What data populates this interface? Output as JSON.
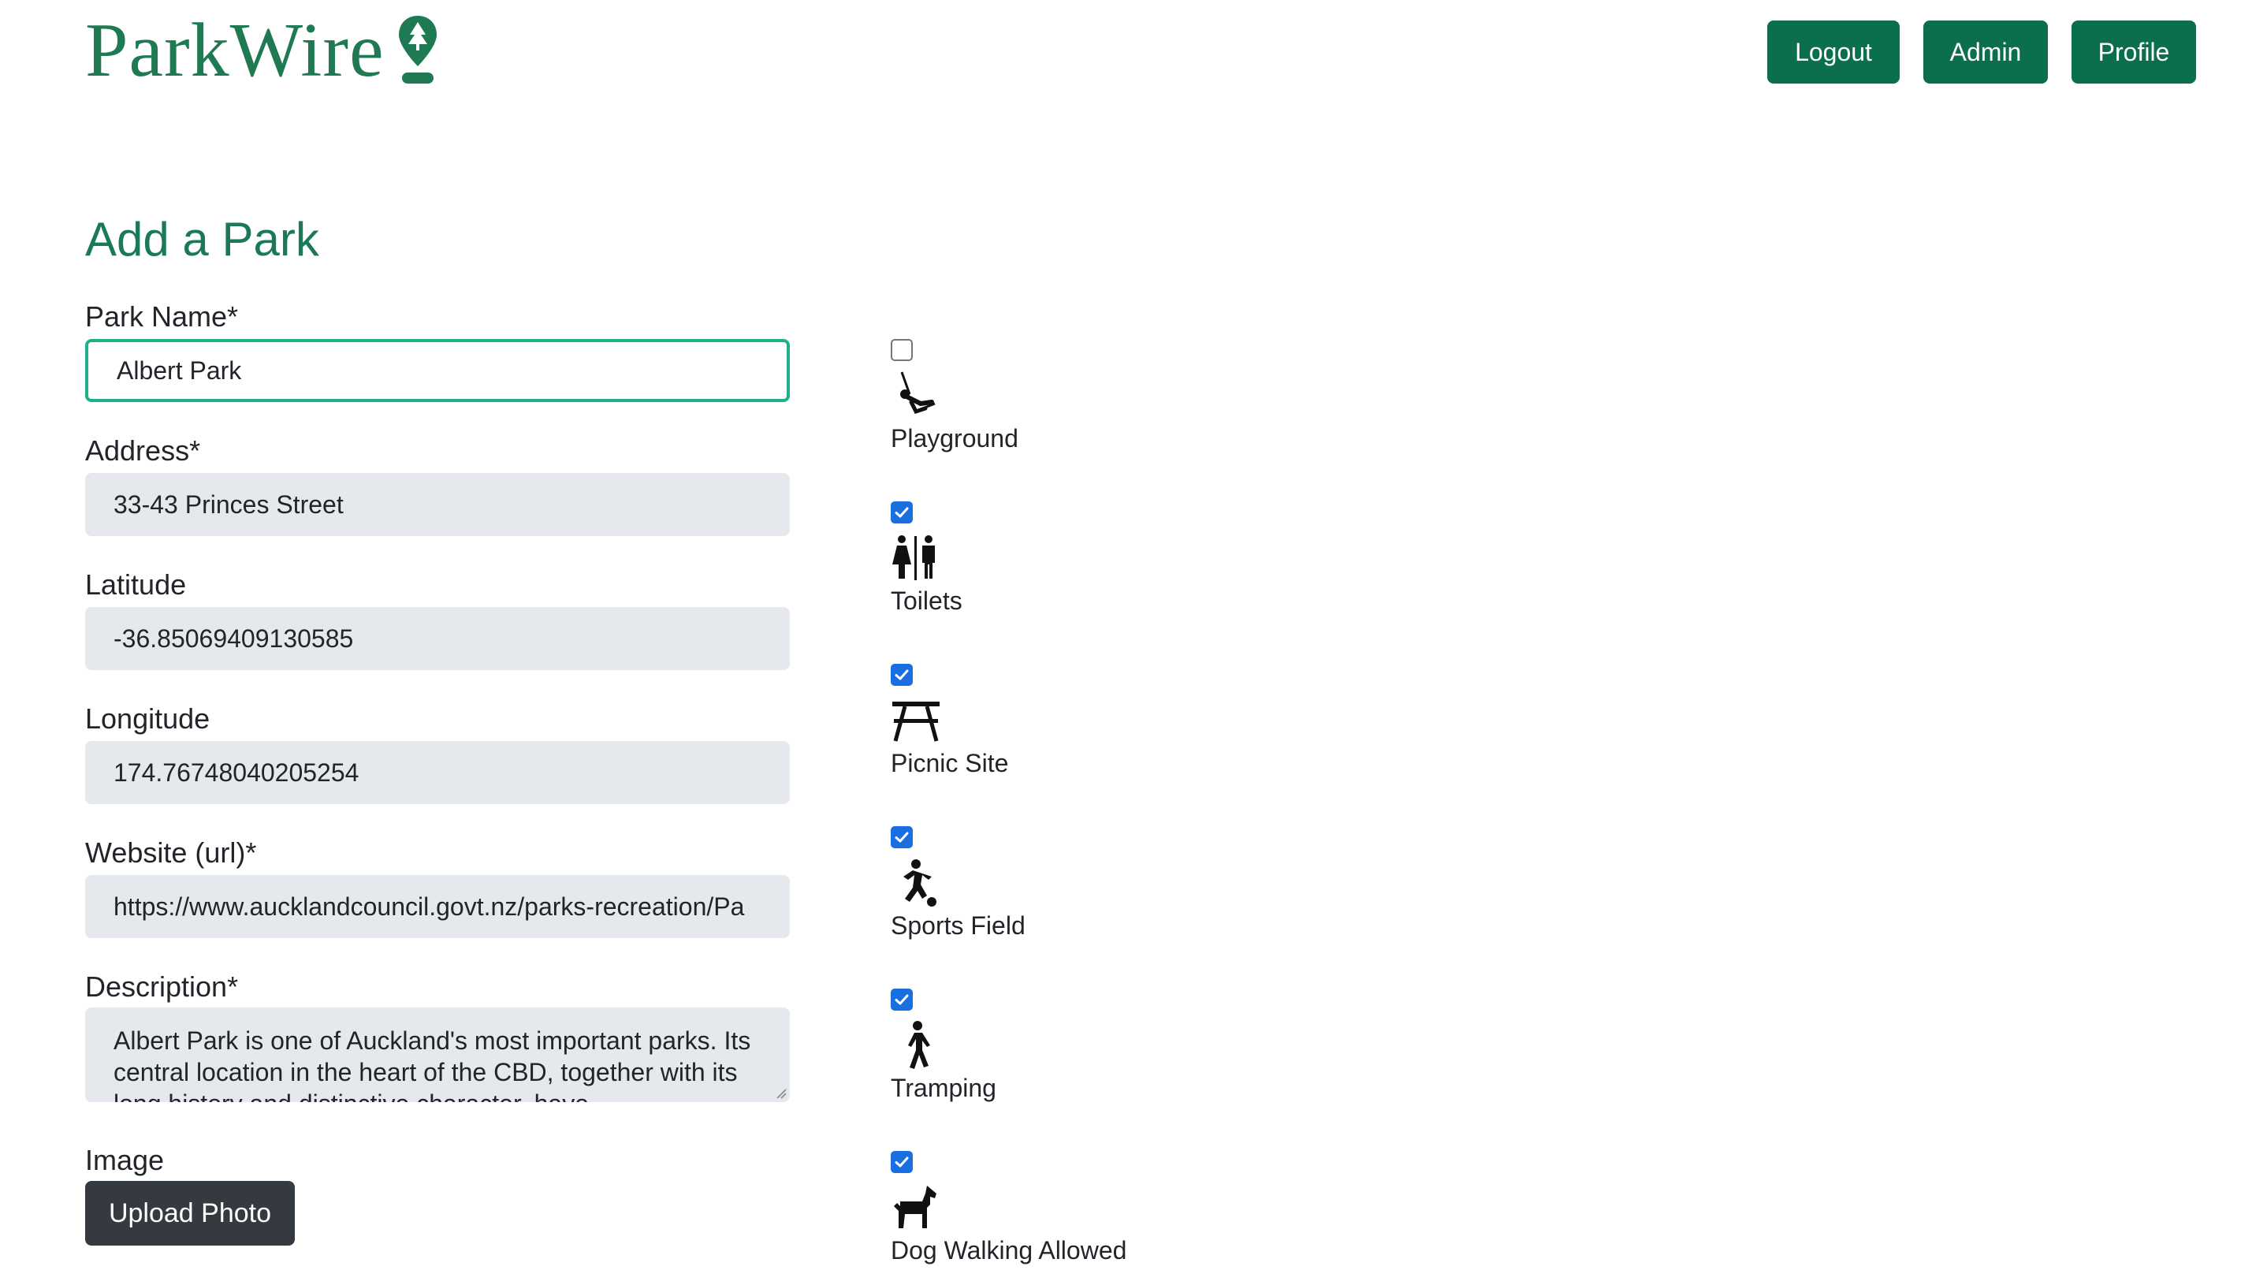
{
  "header": {
    "logo_text": "ParkWire",
    "nav": {
      "logout": "Logout",
      "admin": "Admin",
      "profile": "Profile"
    }
  },
  "form": {
    "title": "Add a Park",
    "park_name": {
      "label": "Park Name*",
      "value": "Albert Park"
    },
    "address": {
      "label": "Address*",
      "value": "33-43 Princes Street"
    },
    "latitude": {
      "label": "Latitude",
      "value": "-36.85069409130585"
    },
    "longitude": {
      "label": "Longitude",
      "value": "174.76748040205254"
    },
    "website": {
      "label": "Website (url)*",
      "value": "https://www.aucklandcouncil.govt.nz/parks-recreation/Pa"
    },
    "description": {
      "label": "Description*",
      "value": "Albert Park is one of Auckland's most important parks. Its central location in the heart of the CBD, together with its long history and distinctive character, have"
    },
    "image": {
      "label": "Image",
      "upload_label": "Upload Photo"
    }
  },
  "amenities": [
    {
      "label": "Playground",
      "checked": false,
      "icon": "playground-icon"
    },
    {
      "label": "Toilets",
      "checked": true,
      "icon": "toilets-icon"
    },
    {
      "label": "Picnic Site",
      "checked": true,
      "icon": "picnic-table-icon"
    },
    {
      "label": "Sports Field",
      "checked": true,
      "icon": "sports-field-icon"
    },
    {
      "label": "Tramping",
      "checked": true,
      "icon": "hiking-icon"
    },
    {
      "label": "Dog Walking Allowed",
      "checked": true,
      "icon": "dog-icon"
    }
  ],
  "colors": {
    "brand_green": "#1f7a54",
    "button_green": "#0b6e4f",
    "input_bg": "#e5e8ec",
    "focus_border": "#20b089",
    "upload_button": "#343a40",
    "checkbox_blue": "#1a6fe0"
  }
}
